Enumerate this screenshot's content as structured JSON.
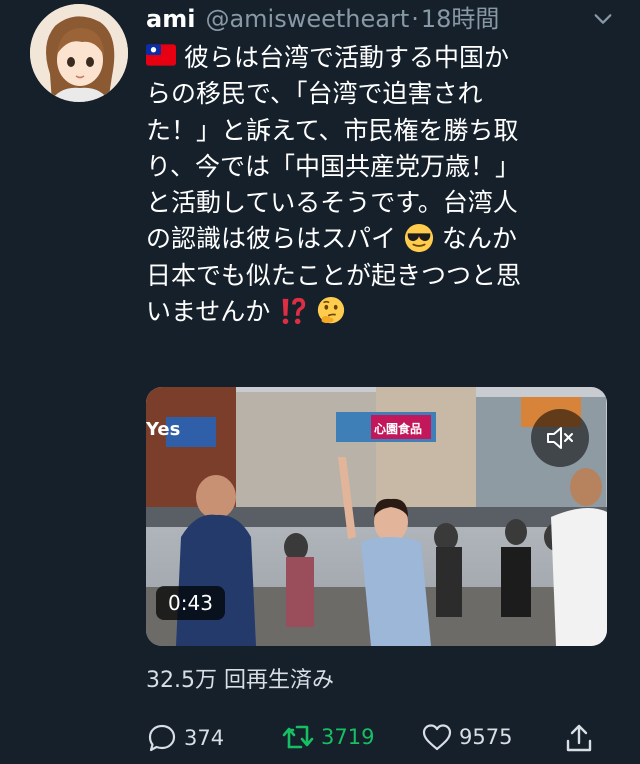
{
  "user": {
    "display_name": "ami",
    "handle": "@amisweetheart",
    "separator": "·",
    "timestamp": "18時間"
  },
  "tweet": {
    "lines": [
      "彼らは台湾で活動する中国か",
      "らの移民で、「台湾で迫害され",
      "た！」と訴えて、市民権を勝ち取",
      "り、今では「中国共産党万歳！」",
      "と活動しているそうです。台湾人",
      "の認識は彼らはスパイ",
      " なんか",
      "日本でも似たことが起きつつと思",
      "いませんか"
    ],
    "emojis": [
      "taiwan-flag",
      "sunglasses-face",
      "exclamation-question-mark",
      "thinking-face"
    ]
  },
  "media": {
    "duration": "0:43",
    "sign_yes": "Yes",
    "sign_shop": "心園食品"
  },
  "views": "32.5万 回再生済み",
  "actions": {
    "reply_count": "374",
    "retweet_count": "3719",
    "like_count": "9575"
  },
  "colors": {
    "background": "#15202b",
    "secondary_text": "#8899a6",
    "retweet_green": "#17bf63"
  },
  "icons": [
    "chevron-down-icon",
    "mute-icon",
    "reply-icon",
    "retweet-icon",
    "like-icon",
    "share-icon"
  ]
}
